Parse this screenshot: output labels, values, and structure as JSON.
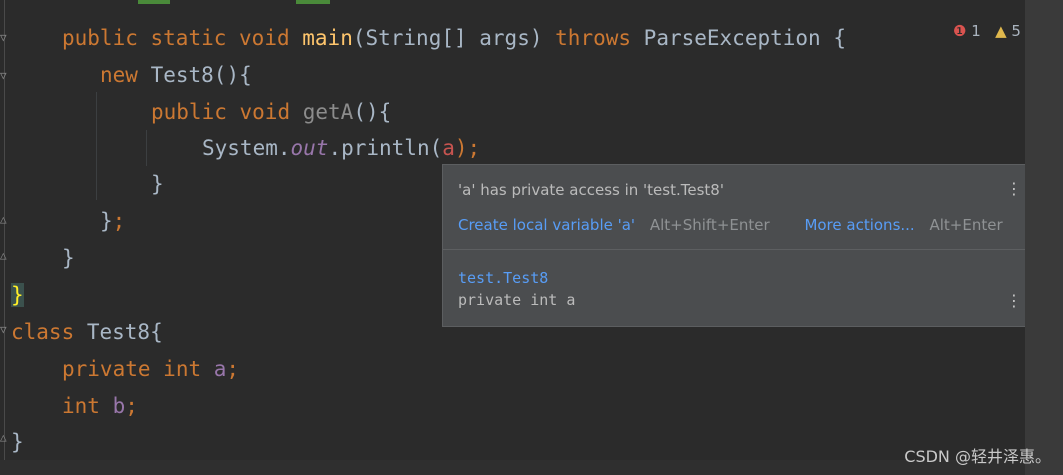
{
  "code": {
    "line1": {
      "mod1": "public",
      "mod2": "static",
      "type": "void",
      "name": "main",
      "params": "(String[] args)",
      "throws": "throws",
      "exc": "ParseException {"
    },
    "line2": {
      "kw": "new",
      "rest": "Test8(){"
    },
    "line3": {
      "mod": "public",
      "type": "void",
      "name": "getA",
      "rest": "(){"
    },
    "line4": {
      "pre": "System.",
      "field": "out",
      "mid": ".println(",
      "arg": "a",
      "end": ");"
    },
    "line5": "}",
    "line6": {
      "brace": "}",
      "semi": ";"
    },
    "line7": "}",
    "line8": "}",
    "line9": {
      "kw": "class",
      "rest": " Test8{"
    },
    "line10": {
      "mod": "private",
      "type": "int",
      "var": "a",
      "semi": ";"
    },
    "line11": {
      "type": "int",
      "var": "b",
      "semi": ";"
    },
    "line12": "}"
  },
  "inspections": {
    "errors": "1",
    "warnings": "5",
    "error_icon": "error-circle-icon",
    "warning_icon": "warning-triangle-icon"
  },
  "popup": {
    "message": "'a' has private access in 'test.Test8'",
    "fix_label": "Create local variable 'a'",
    "fix_shortcut": "Alt+Shift+Enter",
    "more_label": "More actions...",
    "more_shortcut": "Alt+Enter",
    "qualified_name": "test.Test8",
    "signature": "private int a"
  },
  "watermark": "CSDN @轻井泽惠。"
}
